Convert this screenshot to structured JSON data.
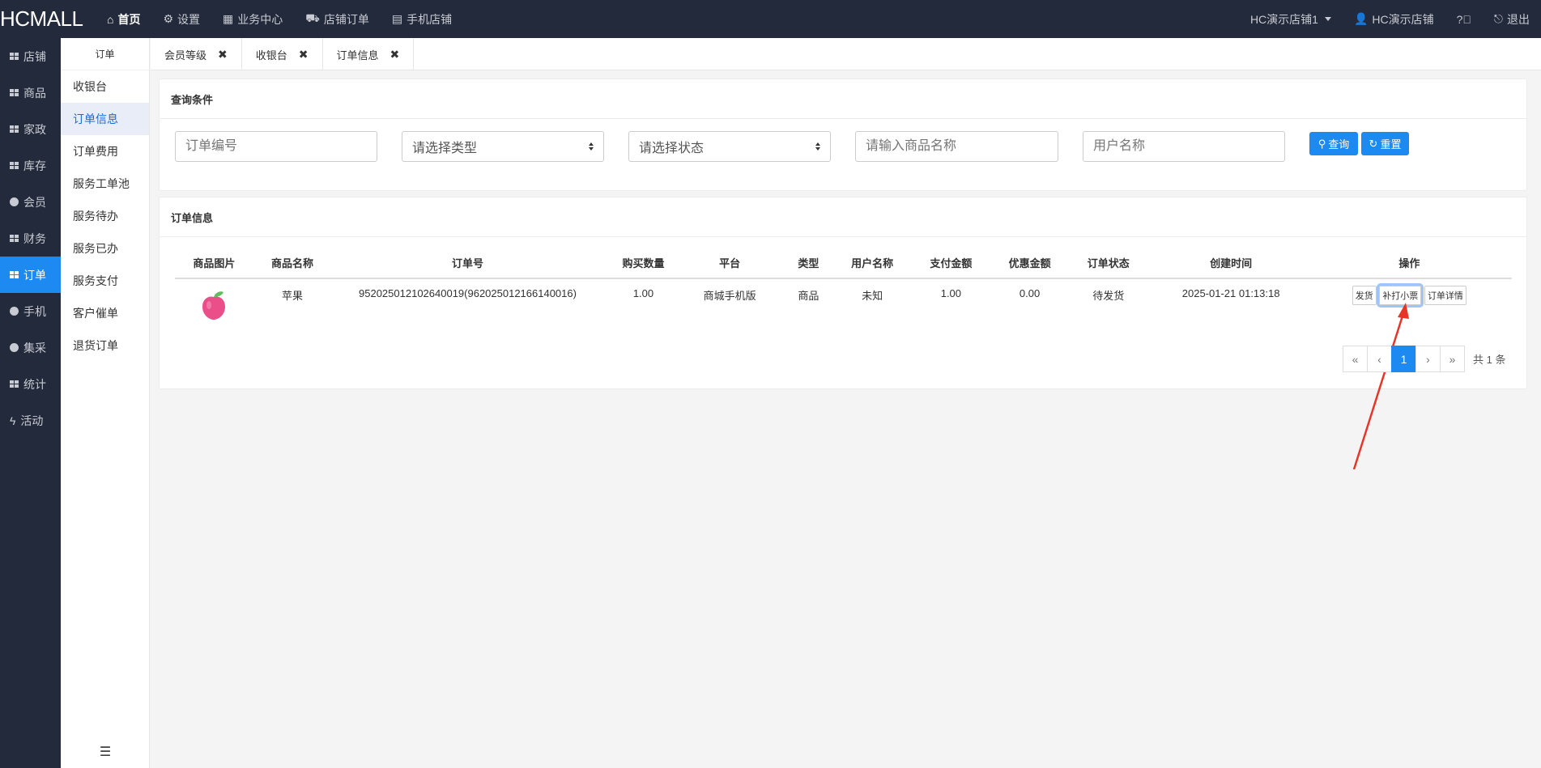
{
  "app": {
    "logo": "HCMALL"
  },
  "topnav": [
    {
      "label": "首页",
      "icon": "home-icon",
      "active": true
    },
    {
      "label": "设置",
      "icon": "gear-icon"
    },
    {
      "label": "业务中心",
      "icon": "calculator-icon"
    },
    {
      "label": "店铺订单",
      "icon": "cart-icon"
    },
    {
      "label": "手机店铺",
      "icon": "mobile-icon"
    }
  ],
  "topright": {
    "store_select": "HC演示店铺1",
    "user": "HC演示店铺",
    "logout": "退出"
  },
  "leftnav": [
    {
      "label": "店铺",
      "icon": "grid-icon"
    },
    {
      "label": "商品",
      "icon": "grid-icon"
    },
    {
      "label": "家政",
      "icon": "grid-icon"
    },
    {
      "label": "库存",
      "icon": "grid-icon"
    },
    {
      "label": "会员",
      "icon": "globe-icon"
    },
    {
      "label": "财务",
      "icon": "grid-icon"
    },
    {
      "label": "订单",
      "icon": "grid-icon",
      "active": true
    },
    {
      "label": "手机",
      "icon": "globe-icon"
    },
    {
      "label": "集采",
      "icon": "globe-icon"
    },
    {
      "label": "统计",
      "icon": "grid-icon"
    },
    {
      "label": "活动",
      "icon": "bolt-icon"
    }
  ],
  "subnav": {
    "header": "订单",
    "items": [
      "收银台",
      "订单信息",
      "订单费用",
      "服务工单池",
      "服务待办",
      "服务已办",
      "服务支付",
      "客户催单",
      "退货订单"
    ],
    "active_index": 1
  },
  "tabs": [
    {
      "label": "会员等级"
    },
    {
      "label": "收银台"
    },
    {
      "label": "订单信息",
      "active": true
    }
  ],
  "query": {
    "title": "查询条件",
    "order_no_placeholder": "订单编号",
    "type_select": "请选择类型",
    "status_select": "请选择状态",
    "product_placeholder": "请输入商品名称",
    "user_placeholder": "用户名称",
    "search_label": "查询",
    "reset_label": "重置"
  },
  "orders": {
    "title": "订单信息",
    "columns": [
      "商品图片",
      "商品名称",
      "订单号",
      "购买数量",
      "平台",
      "类型",
      "用户名称",
      "支付金额",
      "优惠金额",
      "订单状态",
      "创建时间",
      "操作"
    ],
    "rows": [
      {
        "product_name": "苹果",
        "order_no": "952025012102640019(962025012166140016)",
        "quantity": "1.00",
        "platform": "商城手机版",
        "type": "商品",
        "user": "未知",
        "paid": "1.00",
        "discount": "0.00",
        "status": "待发货",
        "created": "2025-01-21 01:13:18",
        "actions": [
          "发货",
          "补打小票",
          "订单详情"
        ]
      }
    ],
    "pager": {
      "first": "«",
      "prev": "‹",
      "current": "1",
      "next": "›",
      "last": "»",
      "total": "共 1 条"
    }
  }
}
